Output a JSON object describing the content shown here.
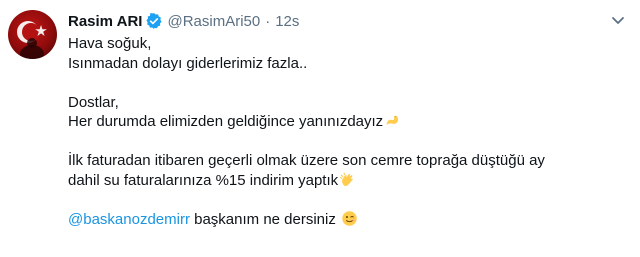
{
  "tweet": {
    "display_name": "Rasim ARI",
    "handle": "@RasimAri50",
    "separator": "·",
    "time": "12s",
    "lines": {
      "l1": "Hava soğuk,",
      "l2": "Isınmadan dolayı giderlerimiz fazla..",
      "l3": "Dostlar,",
      "l4": "Her durumda elimizden geldiğince yanınızdayız",
      "l5": "İlk faturadan itibaren geçerli olmak üzere son cemre toprağa düştüğü ay",
      "l6": "dahil su faturalarınıza %15 indirim yaptık",
      "mention": "@baskanozdemirr",
      "l7_rest": " başkanım ne dersiniz "
    },
    "icons": {
      "verified": "verified-badge-icon",
      "menu": "chevron-down-icon",
      "emoji_1": "flexed-biceps-emoji",
      "emoji_2": "clapping-hands-emoji",
      "emoji_3": "winking-face-emoji"
    },
    "colors": {
      "text": "#0f1419",
      "secondary": "#5b7083",
      "link": "#1b95e0",
      "verified": "#1da1f2"
    }
  }
}
